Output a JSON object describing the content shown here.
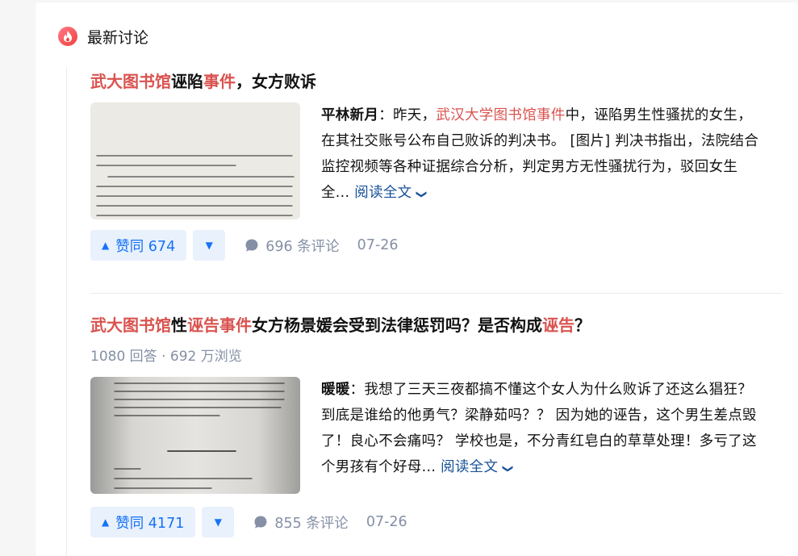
{
  "section": {
    "title": "最新讨论",
    "icon": "flame-icon",
    "icon_color": "#f1403c"
  },
  "items": [
    {
      "title_parts": [
        {
          "text": "武大图书馆",
          "hl": true
        },
        {
          "text": "诬陷",
          "hl": false
        },
        {
          "text": "事件",
          "hl": true
        },
        {
          "text": "，女方败诉",
          "hl": false
        }
      ],
      "author": "平林新月",
      "excerpt_parts": [
        {
          "text": "：昨天，",
          "hl": false
        },
        {
          "text": "武汉大学图书馆事件",
          "hl": true
        },
        {
          "text": "中，诬陷男生性骚扰的女生，在其社交账号公布自己败诉的判决书。 [图片] 判决书指出，法院结合监控视频等各种证据综合分析，判定男方无性骚扰行为，驳回女生全...",
          "hl": false
        }
      ],
      "read_more": "阅读全文",
      "upvote_label": "赞同 674",
      "comments_label": "696 条评论",
      "date": "07-26"
    },
    {
      "title_parts": [
        {
          "text": "武大图书馆",
          "hl": true
        },
        {
          "text": "性",
          "hl": false
        },
        {
          "text": "诬告事件",
          "hl": true
        },
        {
          "text": "女方杨景媛会受到法律惩罚吗？是否构成",
          "hl": false
        },
        {
          "text": "诬告",
          "hl": true
        },
        {
          "text": "？",
          "hl": false
        }
      ],
      "meta": "1080 回答 · 692 万浏览",
      "author": "暖暖",
      "excerpt_parts": [
        {
          "text": "：我想了三天三夜都搞不懂这个女人为什么败诉了还这么猖狂？到底是谁给的他勇气？梁静茹吗？？ 因为她的诬告，这个男生差点毁了！良心不会痛吗？ 学校也是，不分青红皂白的草草处理！多亏了这个男孩有个好母...",
          "hl": false
        }
      ],
      "read_more": "阅读全文",
      "upvote_label": "赞同 4171",
      "comments_label": "855 条评论",
      "date": "07-26"
    }
  ],
  "colors": {
    "highlight": "#d9534f",
    "accent": "#1772f6",
    "link": "#175199",
    "meta": "#8590a6"
  }
}
